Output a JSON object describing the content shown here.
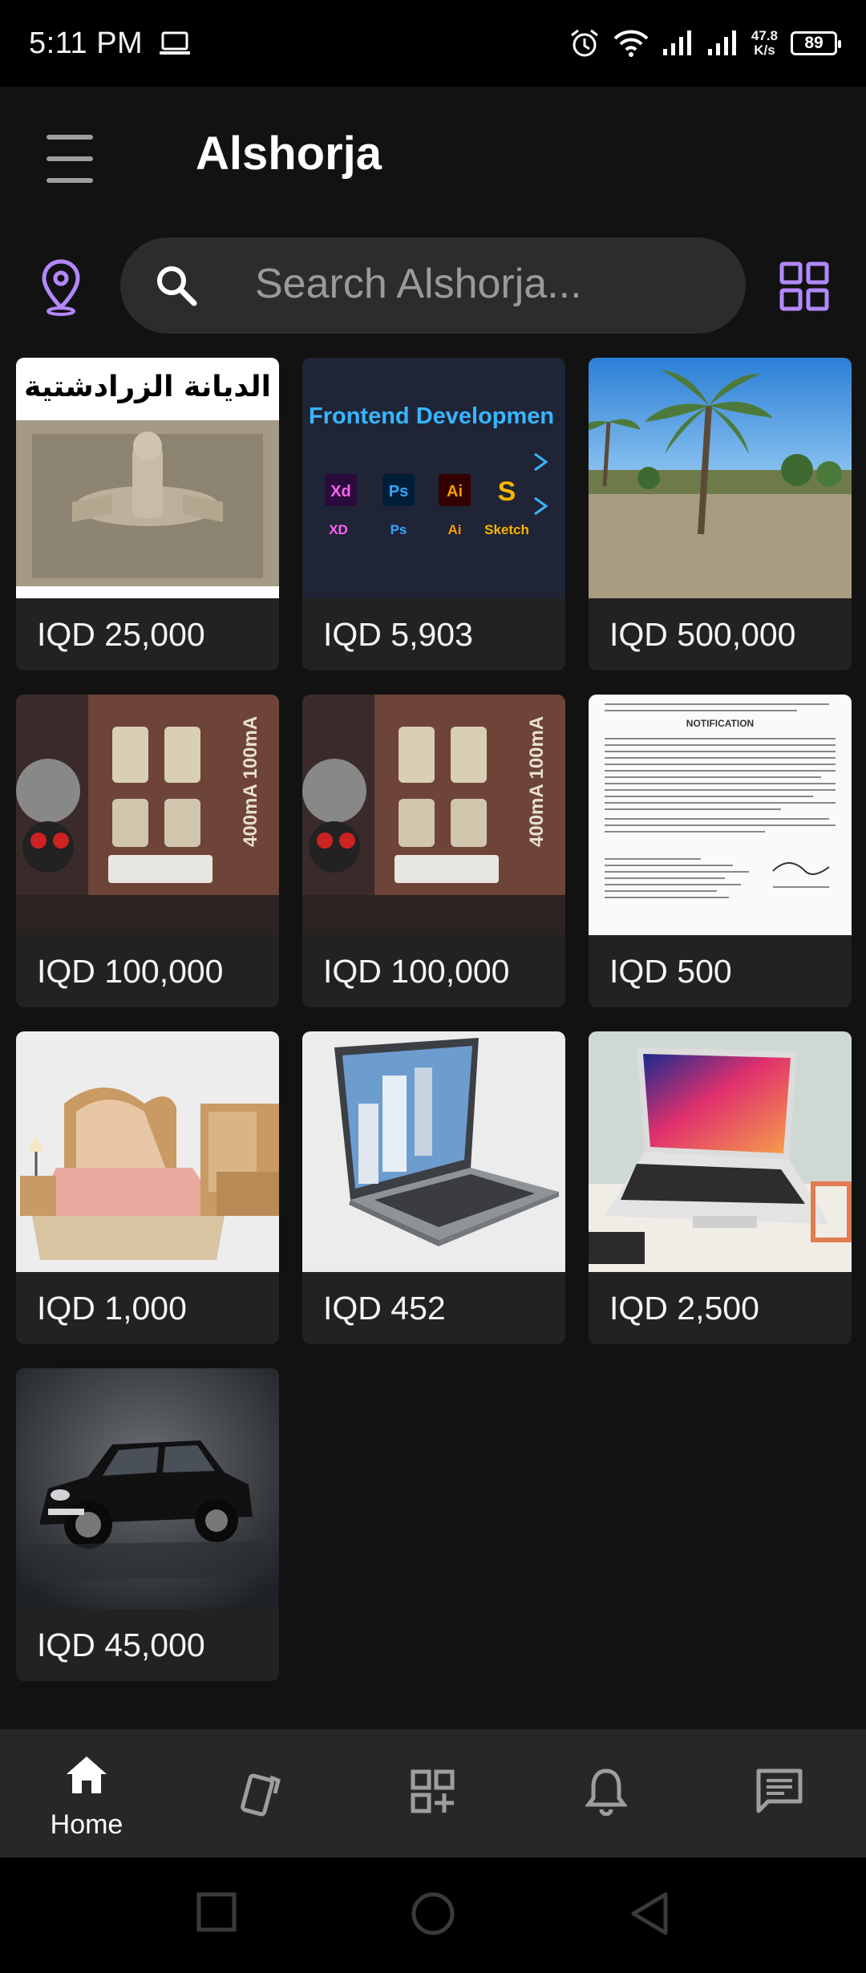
{
  "status_bar": {
    "time": "5:11 PM",
    "net_speed_value": "47.8",
    "net_speed_unit": "K/s",
    "battery": "89"
  },
  "app_bar": {
    "title": "Alshorja"
  },
  "search": {
    "placeholder": "Search Alshorja..."
  },
  "products": [
    {
      "price": "IQD 25,000",
      "image": "zoroastrian-book-cover",
      "caption": "الديانة الزرادشتية"
    },
    {
      "price": "IQD 5,903",
      "image": "frontend-development-banner",
      "caption": "Frontend Developmen",
      "tools": [
        "Xd",
        "Ps",
        "Ai",
        "S"
      ],
      "tool_labels": [
        "XD",
        "Ps",
        "Ai",
        "Sketch"
      ]
    },
    {
      "price": "IQD 500,000",
      "image": "land-with-palm-trees"
    },
    {
      "price": "IQD 100,000",
      "image": "electrical-fuse-unit",
      "caption": "400mA 100mA"
    },
    {
      "price": "IQD 100,000",
      "image": "electrical-fuse-unit",
      "caption": "400mA 100mA"
    },
    {
      "price": "IQD 500",
      "image": "notification-document",
      "caption": "NOTIFICATION"
    },
    {
      "price": "IQD 1,000",
      "image": "bedroom-set"
    },
    {
      "price": "IQD 452",
      "image": "gray-laptop"
    },
    {
      "price": "IQD 2,500",
      "image": "white-laptop"
    },
    {
      "price": "IQD 45,000",
      "image": "black-mini-car"
    }
  ],
  "bottom_nav": {
    "home_label": "Home",
    "active": "home"
  },
  "colors": {
    "accent": "#b388ff",
    "background": "#121212",
    "card": "#222222"
  }
}
